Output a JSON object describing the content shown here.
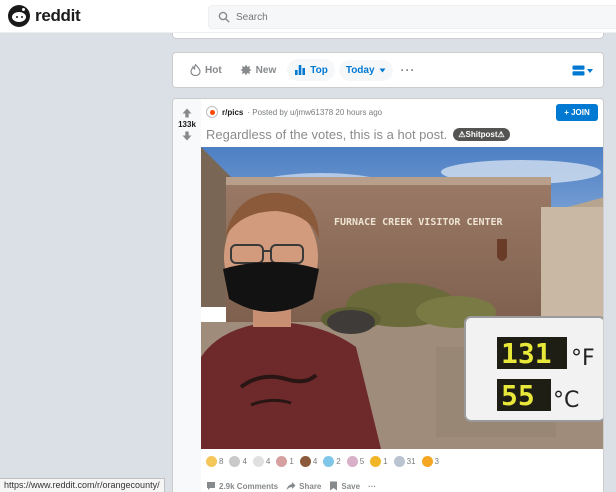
{
  "header": {
    "logo_text": "reddit",
    "search_placeholder": "Search"
  },
  "sortbar": {
    "items": [
      {
        "label": "Hot",
        "icon": "flame-icon",
        "active": false
      },
      {
        "label": "New",
        "icon": "new-burst-icon",
        "active": false
      },
      {
        "label": "Top",
        "icon": "top-bars-icon",
        "active": true
      }
    ],
    "time_filter": "Today",
    "more": "···"
  },
  "post": {
    "vote_count": "133k",
    "subreddit": "r/pics",
    "posted_by": "· Posted by u/jmw61378 20 hours ago",
    "join_label": "+ JOIN",
    "title": "Regardless of the votes, this is a hot post.",
    "flair": "⚠Shitpost⚠",
    "image": {
      "sign_text": "FURNACE  CREEK  VISITOR  CENTER",
      "display_temp_f": "131",
      "display_unit_f": "°F",
      "display_temp_c": "55",
      "display_unit_c": "°C"
    },
    "awards": [
      {
        "icon": "silver-award-icon",
        "count": "8",
        "color": "#f5c65a"
      },
      {
        "icon": "wholesome-award-icon",
        "count": "4",
        "color": "#c9c9c9"
      },
      {
        "icon": "laughing-award-icon",
        "count": "4",
        "color": "#e0e0e0"
      },
      {
        "icon": "helpful-award-icon",
        "count": "1",
        "color": "#d6a0a0"
      },
      {
        "icon": "poop-award-icon",
        "count": "4",
        "color": "#8a5a3a"
      },
      {
        "icon": "hugz-award-icon",
        "count": "2",
        "color": "#7fc6e8"
      },
      {
        "icon": "face-award-icon",
        "count": "5",
        "color": "#d8b0c8"
      },
      {
        "icon": "gold-award-icon",
        "count": "1",
        "color": "#f1b628"
      },
      {
        "icon": "wow-award-icon",
        "count": "31",
        "color": "#b9c4d0"
      },
      {
        "icon": "sunglasses-award-icon",
        "count": "3",
        "color": "#f5a623"
      }
    ],
    "actions": {
      "comments": "2.9k Comments",
      "share": "Share",
      "save": "Save",
      "more": "···"
    }
  },
  "status_bar_url": "https://www.reddit.com/r/orangecounty/"
}
